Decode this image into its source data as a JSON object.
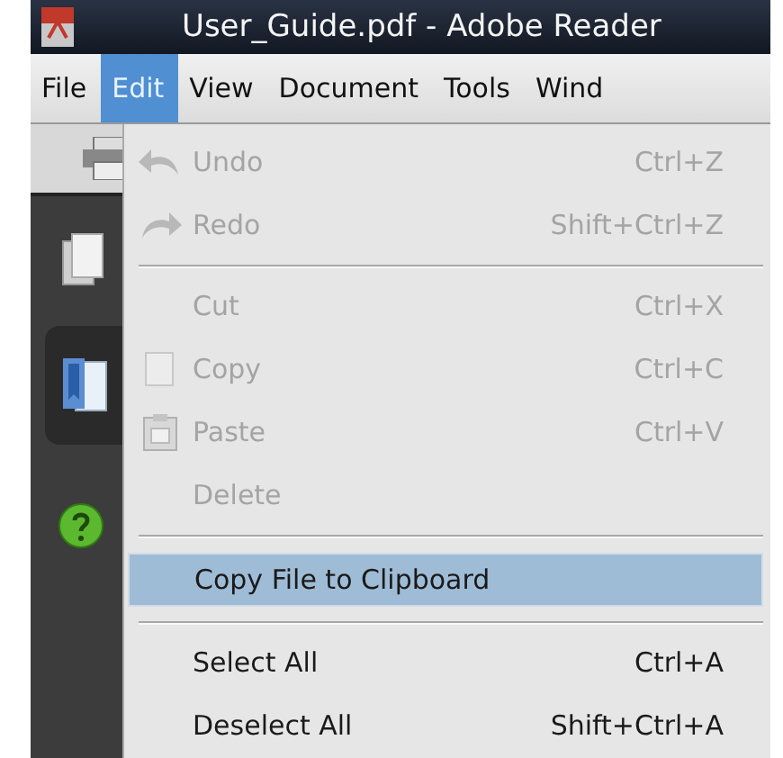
{
  "window": {
    "title": "User_Guide.pdf - Adobe Reader"
  },
  "menu_bar": [
    {
      "label": "File",
      "selected": false
    },
    {
      "label": "Edit",
      "selected": true
    },
    {
      "label": "View",
      "selected": false
    },
    {
      "label": "Document",
      "selected": false
    },
    {
      "label": "Tools",
      "selected": false
    },
    {
      "label": "Wind",
      "selected": false
    }
  ],
  "edit_menu": [
    {
      "kind": "item",
      "label": "Undo",
      "shortcut": "Ctrl+Z",
      "disabled": true,
      "selected": false
    },
    {
      "kind": "item",
      "label": "Redo",
      "shortcut": "Shift+Ctrl+Z",
      "disabled": true,
      "selected": false
    },
    {
      "kind": "separator"
    },
    {
      "kind": "item",
      "label": "Cut",
      "shortcut": "Ctrl+X",
      "disabled": true,
      "selected": false
    },
    {
      "kind": "item",
      "label": "Copy",
      "shortcut": "Ctrl+C",
      "disabled": true,
      "selected": false
    },
    {
      "kind": "item",
      "label": "Paste",
      "shortcut": "Ctrl+V",
      "disabled": true,
      "selected": false
    },
    {
      "kind": "item",
      "label": "Delete",
      "disabled": true,
      "selected": false
    },
    {
      "kind": "separator"
    },
    {
      "kind": "item",
      "label": "Copy File to Clipboard",
      "disabled": false,
      "selected": true
    },
    {
      "kind": "separator"
    },
    {
      "kind": "item",
      "label": "Select All",
      "shortcut": "Ctrl+A",
      "disabled": false,
      "selected": false
    },
    {
      "kind": "item",
      "label": "Deselect All",
      "shortcut": "Shift+Ctrl+A",
      "disabled": false,
      "selected": false
    }
  ]
}
